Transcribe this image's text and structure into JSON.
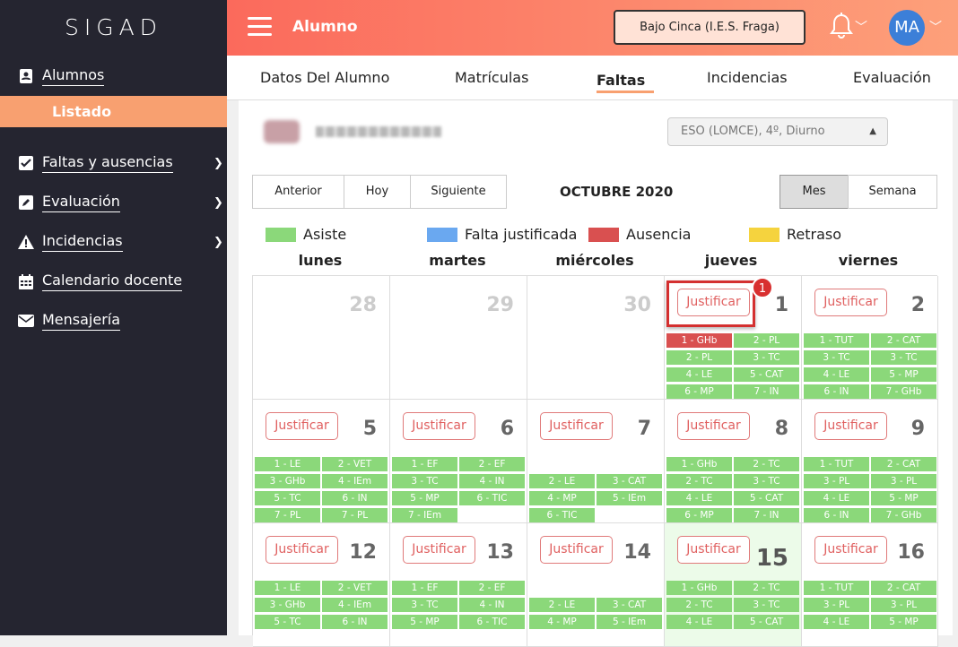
{
  "app": {
    "logo": "SIGAD"
  },
  "sidebar": {
    "section": "Alumnos",
    "subitem": "Listado",
    "items": [
      {
        "label": "Faltas y ausencias",
        "icon": "checkbox-icon"
      },
      {
        "label": "Evaluación",
        "icon": "edit-icon"
      },
      {
        "label": "Incidencias",
        "icon": "warning-icon"
      },
      {
        "label": "Calendario docente",
        "icon": "calendar-icon"
      },
      {
        "label": "Mensajería",
        "icon": "envelope-icon"
      }
    ]
  },
  "header": {
    "title": "Alumno",
    "center": "Bajo Cinca (I.E.S. Fraga)",
    "avatar": "MA"
  },
  "tabs": [
    "Datos Del Alumno",
    "Matrículas",
    "Faltas",
    "Incidencias",
    "Evaluación"
  ],
  "active_tab": "Faltas",
  "student": {
    "course": "ESO (LOMCE), 4º, Diurno"
  },
  "nav": {
    "prev": "Anterior",
    "today": "Hoy",
    "next": "Siguiente",
    "month_view": "Mes",
    "week_view": "Semana"
  },
  "month": "OCTUBRE 2020",
  "legend": [
    {
      "label": "Asiste",
      "color": "#8bd87a"
    },
    {
      "label": "Falta justificada",
      "color": "#6aa8f0"
    },
    {
      "label": "Ausencia",
      "color": "#d95050"
    },
    {
      "label": "Retraso",
      "color": "#f5d33e"
    }
  ],
  "weekdays": [
    "lunes",
    "martes",
    "miércoles",
    "jueves",
    "viernes"
  ],
  "justify_label": "Justificar",
  "badge": "1",
  "weeks": [
    [
      {
        "day": "28",
        "faded": true,
        "justify": false,
        "sessions": []
      },
      {
        "day": "29",
        "faded": true,
        "justify": false,
        "sessions": []
      },
      {
        "day": "30",
        "faded": true,
        "justify": false,
        "sessions": []
      },
      {
        "day": "1",
        "justify": true,
        "highlight": true,
        "sessions": [
          [
            "1 - GHb",
            "red"
          ],
          [
            "2 - PL"
          ],
          [
            "2 - PL"
          ],
          [
            "3 - TC"
          ],
          [
            "4 - LE"
          ],
          [
            "5 - CAT"
          ],
          [
            "6 - MP"
          ],
          [
            "7 - IN"
          ]
        ]
      },
      {
        "day": "2",
        "justify": true,
        "sessions": [
          [
            "1 - TUT"
          ],
          [
            "2 - CAT"
          ],
          [
            "3 - TC"
          ],
          [
            "3 - TC"
          ],
          [
            "4 - LE"
          ],
          [
            "5 - MP"
          ],
          [
            "6 - IN"
          ],
          [
            "7 - GHb"
          ]
        ]
      }
    ],
    [
      {
        "day": "5",
        "justify": true,
        "sessions": [
          [
            "1 - LE"
          ],
          [
            "2 - VET"
          ],
          [
            "3 - GHb"
          ],
          [
            "4 - IEm"
          ],
          [
            "5 - TC"
          ],
          [
            "6 - IN"
          ],
          [
            "7 - PL"
          ],
          [
            "7 - PL"
          ]
        ]
      },
      {
        "day": "6",
        "justify": true,
        "sessions": [
          [
            "1 - EF"
          ],
          [
            "2 - EF"
          ],
          [
            "3 - TC"
          ],
          [
            "4 - IN"
          ],
          [
            "5 - MP"
          ],
          [
            "6 - TIC"
          ],
          [
            "7 - IEm"
          ]
        ]
      },
      {
        "day": "7",
        "justify": true,
        "offset": 1,
        "sessions": [
          [
            "2 - LE"
          ],
          [
            "3 - CAT"
          ],
          [
            "4 - MP"
          ],
          [
            "5 - IEm"
          ],
          [
            "6 - TIC"
          ]
        ]
      },
      {
        "day": "8",
        "justify": true,
        "sessions": [
          [
            "1 - GHb"
          ],
          [
            "2 - TC"
          ],
          [
            "2 - TC"
          ],
          [
            "3 - TC"
          ],
          [
            "4 - LE"
          ],
          [
            "5 - CAT"
          ],
          [
            "6 - MP"
          ],
          [
            "7 - IN"
          ]
        ]
      },
      {
        "day": "9",
        "justify": true,
        "sessions": [
          [
            "1 - TUT"
          ],
          [
            "2 - CAT"
          ],
          [
            "3 - PL"
          ],
          [
            "3 - PL"
          ],
          [
            "4 - LE"
          ],
          [
            "5 - MP"
          ],
          [
            "6 - IN"
          ],
          [
            "7 - GHb"
          ]
        ]
      }
    ],
    [
      {
        "day": "12",
        "justify": true,
        "sessions": [
          [
            "1 - LE"
          ],
          [
            "2 - VET"
          ],
          [
            "3 - GHb"
          ],
          [
            "4 - IEm"
          ],
          [
            "5 - TC"
          ],
          [
            "6 - IN"
          ]
        ]
      },
      {
        "day": "13",
        "justify": true,
        "sessions": [
          [
            "1 - EF"
          ],
          [
            "2 - EF"
          ],
          [
            "3 - TC"
          ],
          [
            "4 - IN"
          ],
          [
            "5 - MP"
          ],
          [
            "6 - TIC"
          ]
        ]
      },
      {
        "day": "14",
        "justify": true,
        "offset": 1,
        "sessions": [
          [
            "2 - LE"
          ],
          [
            "3 - CAT"
          ],
          [
            "4 - MP"
          ],
          [
            "5 - IEm"
          ]
        ]
      },
      {
        "day": "15",
        "justify": true,
        "today": true,
        "sessions": [
          [
            "1 - GHb"
          ],
          [
            "2 - TC"
          ],
          [
            "2 - TC"
          ],
          [
            "3 - TC"
          ],
          [
            "4 - LE"
          ],
          [
            "5 - CAT"
          ]
        ]
      },
      {
        "day": "16",
        "justify": true,
        "sessions": [
          [
            "1 - TUT"
          ],
          [
            "2 - CAT"
          ],
          [
            "3 - PL"
          ],
          [
            "3 - PL"
          ],
          [
            "4 - LE"
          ],
          [
            "5 - MP"
          ]
        ]
      }
    ]
  ]
}
